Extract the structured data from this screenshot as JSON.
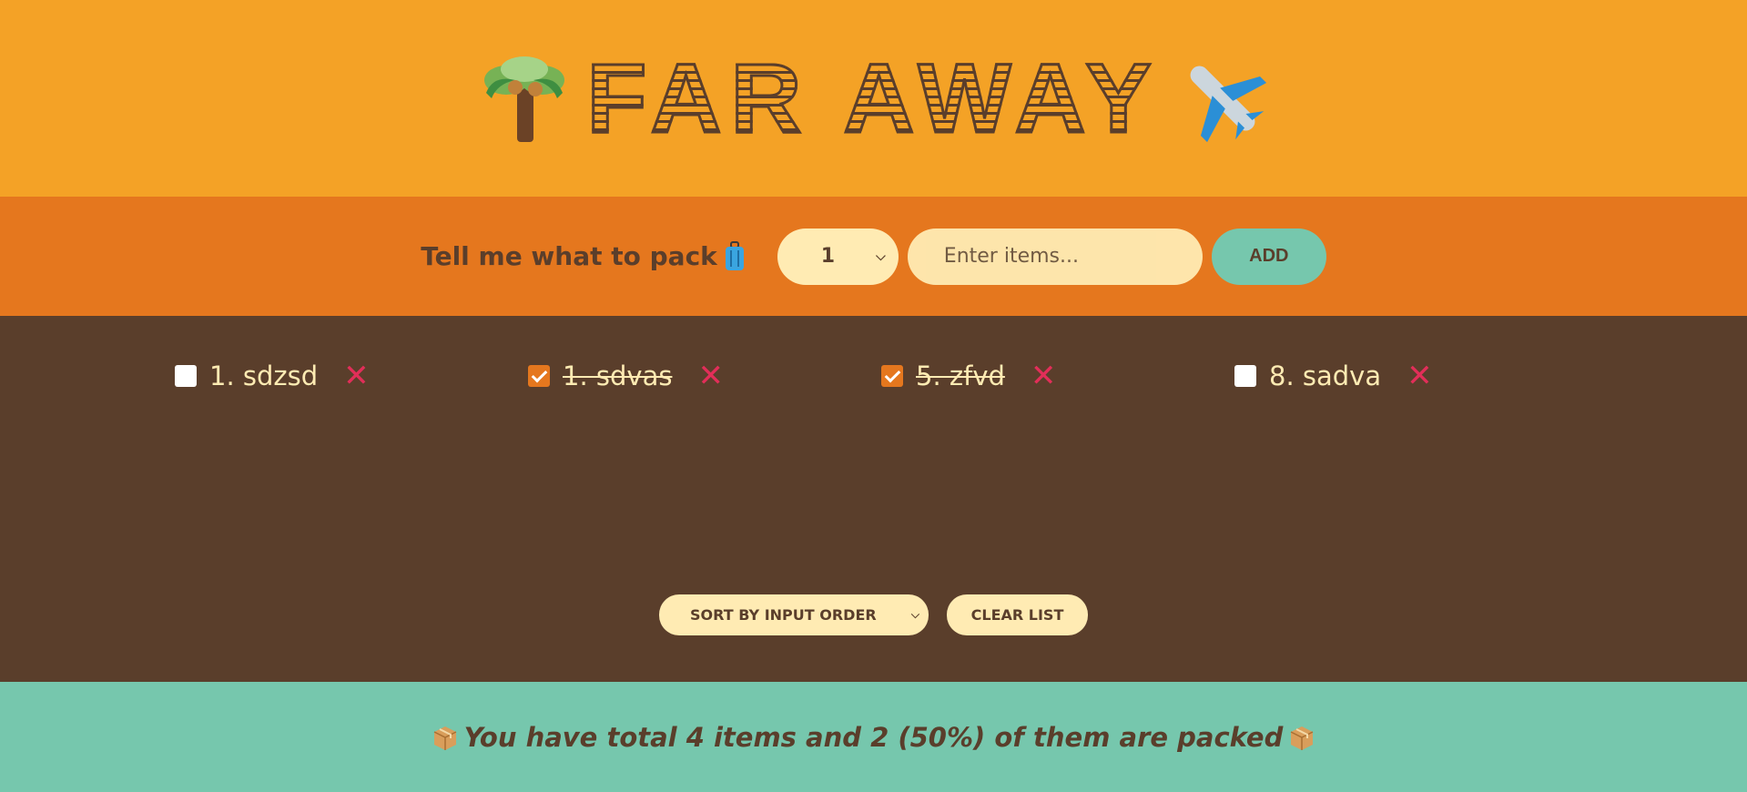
{
  "header": {
    "title": "FAR AWAY",
    "left_icon": "palm-tree-icon",
    "right_icon": "airplane-icon"
  },
  "form": {
    "prompt": "Tell me what to pack",
    "prompt_icon": "luggage-icon",
    "quantity_value": "1",
    "item_placeholder": "Enter items...",
    "add_label": "ADD"
  },
  "items": [
    {
      "label": "1. sdzsd",
      "packed": false
    },
    {
      "label": "1. sdvas",
      "packed": true
    },
    {
      "label": "5. zfvd",
      "packed": true
    },
    {
      "label": "8. sadva",
      "packed": false
    }
  ],
  "actions": {
    "sort_value": "SORT BY INPUT ORDER",
    "clear_label": "CLEAR LIST"
  },
  "stats": {
    "text": "You have total 4 items and 2 (50%) of them are packed",
    "icon": "package-icon"
  },
  "colors": {
    "header": "#f4a226",
    "form": "#e5771e",
    "list": "#5a3e2b",
    "stats": "#76c7ad",
    "delete": "#e22e59",
    "cream": "#ffebb3"
  }
}
